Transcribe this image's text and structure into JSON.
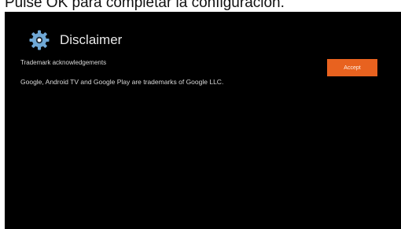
{
  "caption": "Pulse OK para completar la configuración.",
  "dialog": {
    "title": "Disclaimer",
    "subtitle": "Trademark acknowledgements",
    "body": "Google, Android TV and Google Play are trademarks of Google LLC.",
    "accept_label": "Accept",
    "icon": "gear-icon"
  },
  "colors": {
    "background": "#000000",
    "accent": "#e8621f",
    "icon": "#6fa8d6"
  }
}
